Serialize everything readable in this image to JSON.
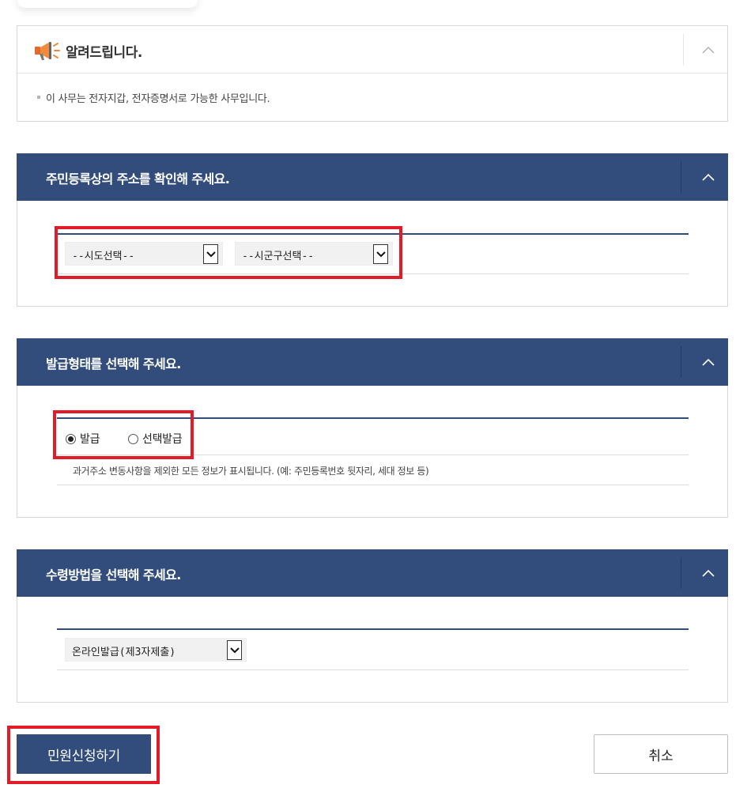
{
  "notice": {
    "title": "알려드립니다.",
    "text": "이 사무는 전자지갑, 전자증명서로 가능한 사무입니다."
  },
  "address_section": {
    "title": "주민등록상의 주소를 확인해 주세요.",
    "province_select": "--시도선택--",
    "district_select": "--시군구선택--"
  },
  "issue_section": {
    "title": "발급형태를 선택해 주세요.",
    "options": [
      {
        "label": "발급",
        "checked": true
      },
      {
        "label": "선택발급",
        "checked": false
      }
    ],
    "description": "과거주소 변동사항을 제외한 모든 정보가 표시됩니다. (예: 주민등록번호 뒷자리, 세대 정보 등)"
  },
  "receive_section": {
    "title": "수령방법을 선택해 주세요.",
    "method_select": "온라인발급(제3자제출)"
  },
  "buttons": {
    "apply": "민원신청하기",
    "cancel": "취소"
  },
  "colors": {
    "header_navy": "#324d7b",
    "highlight_red": "#e21b28"
  },
  "icons": {
    "notice": "megaphone-icon",
    "toggle": "chevron-up-icon",
    "dropdown": "chevron-down-icon"
  }
}
